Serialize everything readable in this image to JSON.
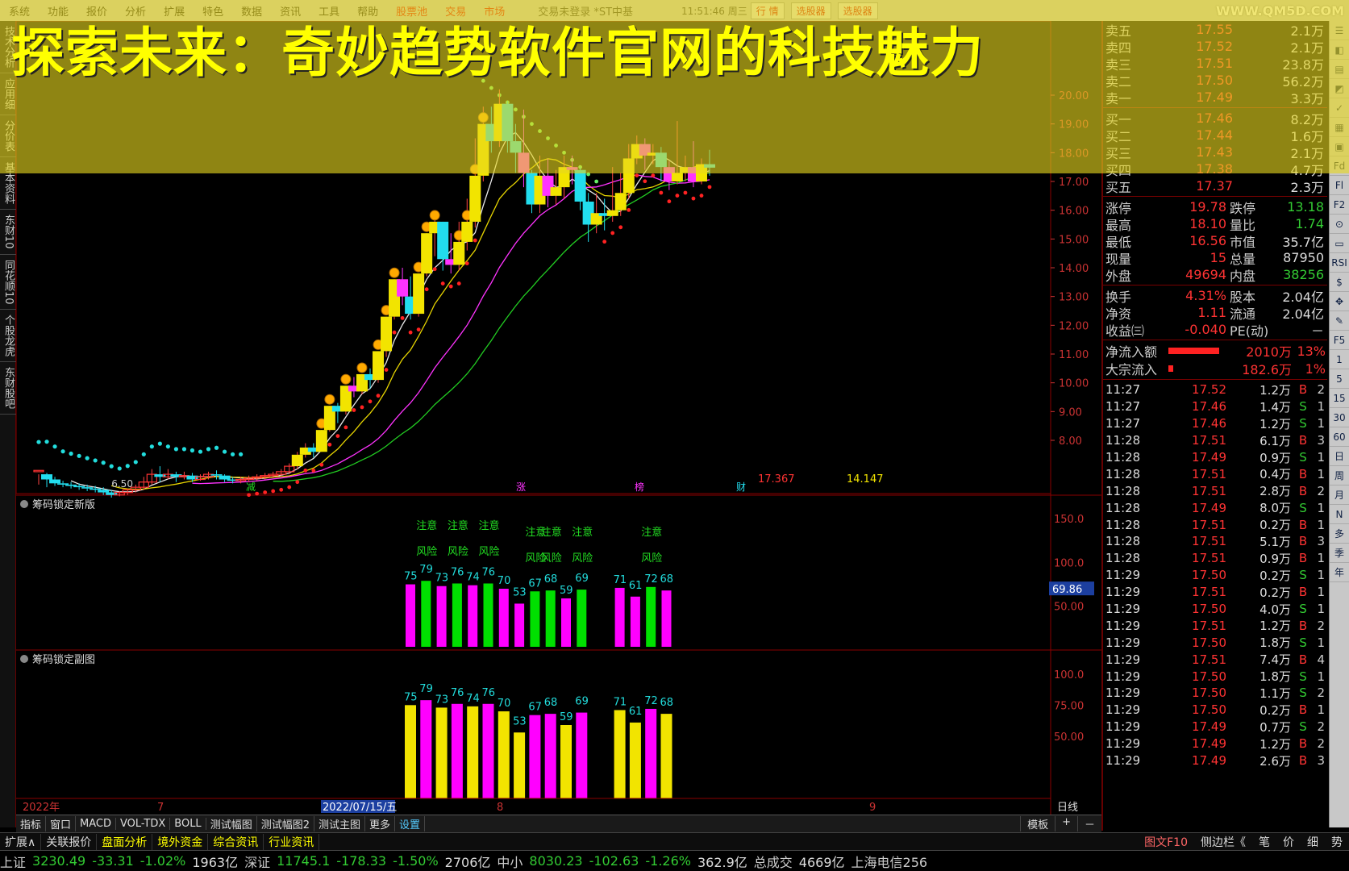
{
  "menubar": {
    "items": [
      "系统",
      "功能",
      "报价",
      "分析",
      "扩展",
      "特色",
      "数据",
      "资讯",
      "工具",
      "帮助"
    ],
    "red_items": [
      "股票池",
      "交易",
      "市场"
    ],
    "buttons": [
      "行 情",
      "选股器",
      "选股器"
    ],
    "window_title": "交易未登录 *ST中基",
    "clock": "11:51:46 周三",
    "site": "WWW.QM5D.COM"
  },
  "headline": "探索未来：奇妙趋势软件官网的科技魅力",
  "left_vertical_tabs": [
    "技术分析",
    "应用细",
    "分价表",
    "基本资料",
    "东财10",
    "同花顺10",
    "个股龙虎",
    "东财股吧"
  ],
  "right_toolbar": [
    "☰",
    "◧",
    "▤",
    "◩",
    "✓",
    "▦",
    "▣",
    "Fd",
    "Fl",
    "F2",
    "⊙",
    "▭",
    "RSI",
    "$",
    "✥",
    "✎",
    "F5",
    "1",
    "5",
    "15",
    "30",
    "60",
    "日",
    "周",
    "月",
    "N",
    "多",
    "季",
    "年"
  ],
  "quote": {
    "orderbook": [
      {
        "label": "卖五",
        "price": "17.55",
        "vol": "2.1万"
      },
      {
        "label": "卖四",
        "price": "17.52",
        "vol": "2.1万"
      },
      {
        "label": "卖三",
        "price": "17.51",
        "vol": "23.8万"
      },
      {
        "label": "卖二",
        "price": "17.50",
        "vol": "56.2万"
      },
      {
        "label": "卖一",
        "price": "17.49",
        "vol": "3.3万"
      },
      {
        "label": "买一",
        "price": "17.46",
        "vol": "8.2万"
      },
      {
        "label": "买二",
        "price": "17.44",
        "vol": "1.6万"
      },
      {
        "label": "买三",
        "price": "17.43",
        "vol": "2.1万"
      },
      {
        "label": "买四",
        "price": "17.38",
        "vol": "4.7万"
      },
      {
        "label": "买五",
        "price": "17.37",
        "vol": "2.3万"
      }
    ],
    "stats": [
      {
        "k1": "涨停",
        "v1": "19.78",
        "k2": "跌停",
        "v2": "13.18",
        "v2color": "g"
      },
      {
        "k1": "最高",
        "v1": "18.10",
        "k2": "量比",
        "v2": "1.74",
        "v2color": "g"
      },
      {
        "k1": "最低",
        "v1": "16.56",
        "k2": "市值",
        "v2": "35.7亿",
        "v2color": "w"
      },
      {
        "k1": "现量",
        "v1": "15",
        "k2": "总量",
        "v2": "87950",
        "v2color": "w"
      },
      {
        "k1": "外盘",
        "v1": "49694",
        "k2": "内盘",
        "v2": "38256",
        "v2color": "g"
      }
    ],
    "stats2": [
      {
        "k1": "换手",
        "v1": "4.31%",
        "k2": "股本",
        "v2": "2.04亿",
        "v2color": "w"
      },
      {
        "k1": "净资",
        "v1": "1.11",
        "k2": "流通",
        "v2": "2.04亿",
        "v2color": "w"
      },
      {
        "k1": "收益㈢",
        "v1": "-0.040",
        "k2": "PE(动)",
        "v2": "－",
        "v2color": "w"
      }
    ],
    "flows": [
      {
        "label": "净流入额",
        "value": "2010万",
        "pct": "13%",
        "bar": 0.9
      },
      {
        "label": "大宗流入",
        "value": "182.6万",
        "pct": "1%",
        "bar": 0.08
      }
    ],
    "ticks": [
      {
        "t": "11:27",
        "p": "17.52",
        "v": "1.2万",
        "bs": "B",
        "n": "2"
      },
      {
        "t": "11:27",
        "p": "17.46",
        "v": "1.4万",
        "bs": "S",
        "n": "1"
      },
      {
        "t": "11:27",
        "p": "17.46",
        "v": "1.2万",
        "bs": "S",
        "n": "1"
      },
      {
        "t": "11:28",
        "p": "17.51",
        "v": "6.1万",
        "bs": "B",
        "n": "3"
      },
      {
        "t": "11:28",
        "p": "17.49",
        "v": "0.9万",
        "bs": "S",
        "n": "1"
      },
      {
        "t": "11:28",
        "p": "17.51",
        "v": "0.4万",
        "bs": "B",
        "n": "1"
      },
      {
        "t": "11:28",
        "p": "17.51",
        "v": "2.8万",
        "bs": "B",
        "n": "2"
      },
      {
        "t": "11:28",
        "p": "17.49",
        "v": "8.0万",
        "bs": "S",
        "n": "1"
      },
      {
        "t": "11:28",
        "p": "17.51",
        "v": "0.2万",
        "bs": "B",
        "n": "1"
      },
      {
        "t": "11:28",
        "p": "17.51",
        "v": "5.1万",
        "bs": "B",
        "n": "3"
      },
      {
        "t": "11:28",
        "p": "17.51",
        "v": "0.9万",
        "bs": "B",
        "n": "1"
      },
      {
        "t": "11:29",
        "p": "17.50",
        "v": "0.2万",
        "bs": "S",
        "n": "1"
      },
      {
        "t": "11:29",
        "p": "17.51",
        "v": "0.2万",
        "bs": "B",
        "n": "1"
      },
      {
        "t": "11:29",
        "p": "17.50",
        "v": "4.0万",
        "bs": "S",
        "n": "1"
      },
      {
        "t": "11:29",
        "p": "17.51",
        "v": "1.2万",
        "bs": "B",
        "n": "2"
      },
      {
        "t": "11:29",
        "p": "17.50",
        "v": "1.8万",
        "bs": "S",
        "n": "1"
      },
      {
        "t": "11:29",
        "p": "17.51",
        "v": "7.4万",
        "bs": "B",
        "n": "4"
      },
      {
        "t": "11:29",
        "p": "17.50",
        "v": "1.8万",
        "bs": "S",
        "n": "1"
      },
      {
        "t": "11:29",
        "p": "17.50",
        "v": "1.1万",
        "bs": "S",
        "n": "2"
      },
      {
        "t": "11:29",
        "p": "17.50",
        "v": "0.2万",
        "bs": "B",
        "n": "1"
      },
      {
        "t": "11:29",
        "p": "17.49",
        "v": "0.7万",
        "bs": "S",
        "n": "2"
      },
      {
        "t": "11:29",
        "p": "17.49",
        "v": "1.2万",
        "bs": "B",
        "n": "2"
      },
      {
        "t": "11:29",
        "p": "17.49",
        "v": "2.6万",
        "bs": "B",
        "n": "3"
      }
    ]
  },
  "chart_data": {
    "type": "candlestick",
    "main_axis": {
      "labels": [
        "20.00",
        "19.00",
        "18.00",
        "17.00",
        "16.00",
        "15.00",
        "14.00",
        "13.00",
        "12.00",
        "11.00",
        "10.00",
        "9.00",
        "8.00"
      ],
      "range": [
        7.0,
        20.0
      ]
    },
    "low_label": "6.50",
    "high_label": "17.367",
    "mid_label": "14.147",
    "event_markers": [
      "减",
      "涨",
      "榜",
      "财"
    ],
    "candles": [
      [
        6.9,
        6.95,
        6.4,
        6.8
      ],
      [
        6.8,
        6.6,
        6.3,
        6.85
      ],
      [
        6.6,
        6.45,
        6.35,
        6.7
      ],
      [
        6.45,
        6.4,
        6.3,
        6.55
      ],
      [
        6.4,
        6.35,
        6.25,
        6.5
      ],
      [
        6.35,
        6.3,
        6.2,
        6.45
      ],
      [
        6.3,
        6.25,
        6.15,
        6.4
      ],
      [
        6.25,
        6.2,
        6.1,
        6.35
      ],
      [
        6.2,
        6.1,
        6.0,
        6.3
      ],
      [
        6.1,
        6.0,
        5.9,
        6.2
      ],
      [
        6.0,
        6.1,
        5.95,
        6.15
      ],
      [
        6.1,
        6.2,
        6.0,
        6.25
      ],
      [
        6.2,
        6.3,
        6.1,
        6.4
      ],
      [
        6.3,
        6.5,
        6.2,
        6.7
      ],
      [
        6.5,
        6.8,
        6.4,
        7.0
      ],
      [
        6.8,
        6.7,
        6.5,
        7.1
      ],
      [
        6.7,
        6.8,
        6.6,
        7.0
      ],
      [
        6.8,
        6.7,
        6.5,
        6.9
      ],
      [
        6.7,
        6.75,
        6.6,
        6.9
      ],
      [
        6.75,
        6.6,
        6.5,
        6.85
      ],
      [
        6.6,
        6.7,
        6.55,
        6.8
      ],
      [
        6.7,
        6.8,
        6.6,
        6.9
      ],
      [
        6.8,
        6.75,
        6.6,
        6.95
      ],
      [
        6.75,
        6.6,
        6.5,
        6.8
      ],
      [
        6.6,
        6.55,
        6.45,
        6.7
      ],
      [
        6.55,
        6.6,
        6.45,
        6.7
      ],
      [
        6.6,
        6.65,
        6.5,
        6.75
      ],
      [
        6.65,
        6.7,
        6.55,
        6.8
      ],
      [
        6.7,
        6.75,
        6.6,
        6.85
      ],
      [
        6.75,
        6.8,
        6.65,
        6.9
      ],
      [
        6.8,
        6.9,
        6.7,
        7.0
      ],
      [
        6.9,
        7.1,
        6.8,
        7.2
      ],
      [
        7.1,
        7.5,
        7.0,
        7.6
      ],
      [
        7.5,
        7.75,
        7.4,
        7.9
      ],
      [
        7.75,
        7.6,
        7.4,
        7.9
      ],
      [
        7.6,
        8.36,
        7.6,
        8.36
      ],
      [
        8.36,
        9.2,
        8.3,
        9.2
      ],
      [
        9.2,
        9.0,
        8.6,
        9.3
      ],
      [
        9.0,
        9.9,
        8.9,
        9.9
      ],
      [
        9.9,
        9.7,
        9.5,
        10.2
      ],
      [
        9.7,
        10.3,
        9.6,
        10.3
      ],
      [
        10.3,
        10.1,
        9.8,
        10.5
      ],
      [
        10.1,
        11.1,
        10.0,
        11.1
      ],
      [
        11.1,
        12.3,
        10.9,
        12.3
      ],
      [
        12.3,
        13.6,
        12.2,
        13.6
      ],
      [
        13.6,
        13.0,
        12.7,
        14.0
      ],
      [
        13.0,
        12.4,
        12.2,
        13.7
      ],
      [
        12.4,
        13.8,
        12.3,
        13.8
      ],
      [
        13.8,
        15.2,
        13.7,
        15.2
      ],
      [
        15.2,
        15.6,
        14.4,
        15.9
      ],
      [
        15.6,
        14.3,
        13.9,
        15.6
      ],
      [
        14.3,
        14.1,
        13.8,
        15.2
      ],
      [
        14.1,
        14.9,
        13.9,
        15.6
      ],
      [
        14.9,
        15.6,
        14.6,
        16.4
      ],
      [
        15.6,
        17.2,
        15.4,
        18.5
      ],
      [
        17.2,
        19.0,
        17.0,
        19.6
      ],
      [
        19.0,
        18.4,
        18.0,
        19.6
      ],
      [
        18.4,
        19.7,
        18.2,
        20.2
      ],
      [
        19.7,
        18.4,
        18.0,
        19.8
      ],
      [
        18.4,
        18.0,
        17.3,
        19.0
      ],
      [
        18.0,
        17.3,
        16.8,
        19.5
      ],
      [
        17.3,
        16.2,
        15.9,
        17.4
      ],
      [
        16.2,
        17.2,
        15.9,
        17.9
      ],
      [
        17.2,
        16.5,
        16.1,
        17.8
      ],
      [
        16.5,
        16.8,
        16.2,
        17.4
      ],
      [
        16.8,
        17.5,
        16.4,
        17.9
      ],
      [
        17.5,
        17.4,
        16.9,
        17.9
      ],
      [
        17.4,
        16.3,
        16.0,
        17.5
      ],
      [
        16.3,
        15.5,
        14.9,
        16.6
      ],
      [
        15.5,
        15.9,
        15.2,
        16.6
      ],
      [
        15.9,
        15.8,
        15.3,
        16.4
      ],
      [
        15.8,
        16.0,
        15.6,
        17.5
      ],
      [
        16.0,
        16.6,
        15.8,
        17.3
      ],
      [
        16.6,
        17.8,
        16.4,
        18.3
      ],
      [
        17.8,
        18.3,
        17.6,
        18.6
      ],
      [
        18.3,
        17.9,
        17.4,
        18.5
      ],
      [
        17.9,
        18.0,
        17.6,
        18.3
      ],
      [
        18.0,
        17.5,
        17.0,
        18.2
      ],
      [
        17.5,
        17.0,
        16.7,
        17.7
      ],
      [
        17.0,
        17.3,
        16.9,
        19.1
      ],
      [
        17.3,
        17.5,
        17.0,
        17.9
      ],
      [
        17.5,
        17.0,
        16.8,
        18.4
      ],
      [
        17.0,
        17.6,
        16.9,
        17.8
      ],
      [
        17.6,
        17.48,
        17.2,
        18.1
      ]
    ],
    "sub1": {
      "title": "筹码锁定新版",
      "axis": [
        "150.0",
        "100.0",
        "50.00"
      ],
      "range": [
        0,
        175
      ],
      "current": "69.86",
      "values": [
        75,
        79,
        73,
        76,
        74,
        76,
        70,
        53,
        67,
        68,
        59,
        69,
        71,
        61,
        72,
        68
      ],
      "colors": [
        "m",
        "g",
        "m",
        "g",
        "m",
        "g",
        "m",
        "m",
        "g",
        "g",
        "m",
        "g",
        "m",
        "m",
        "g",
        "m"
      ],
      "groups": [
        0,
        0,
        0,
        0,
        0,
        0,
        0,
        0,
        0,
        0,
        0,
        0,
        1,
        1,
        1,
        1
      ],
      "notes": [
        {
          "text": "注意",
          "bar": 1
        },
        {
          "text": "注意",
          "bar": 3
        },
        {
          "text": "注意",
          "bar": 5
        },
        {
          "text": "注意",
          "bar": 8
        },
        {
          "text": "注意",
          "bar": 9
        },
        {
          "text": "注意",
          "bar": 11
        },
        {
          "text": "注意",
          "bar": 14
        }
      ],
      "risks": [
        {
          "text": "风险",
          "bar": 1
        },
        {
          "text": "风险",
          "bar": 3
        },
        {
          "text": "风险",
          "bar": 5
        },
        {
          "text": "风险",
          "bar": 8
        },
        {
          "text": "风险",
          "bar": 9
        },
        {
          "text": "风险",
          "bar": 11
        },
        {
          "text": "风险",
          "bar": 14
        }
      ]
    },
    "sub2": {
      "title": "筹码锁定副图",
      "axis": [
        "100.0",
        "75.00",
        "50.00"
      ],
      "range": [
        0,
        118
      ],
      "values": [
        75,
        79,
        73,
        76,
        74,
        76,
        70,
        53,
        67,
        68,
        59,
        69,
        71,
        61,
        72,
        68
      ],
      "colors": [
        "y",
        "m",
        "y",
        "m",
        "y",
        "m",
        "y",
        "y",
        "m",
        "m",
        "y",
        "m",
        "y",
        "y",
        "m",
        "y"
      ]
    },
    "time_axis": {
      "labels": [
        "2022年",
        "7",
        "2022/07/15/五",
        "8",
        "9"
      ],
      "right": "日线"
    }
  },
  "tabs1": {
    "items": [
      "指标",
      "窗口",
      "MACD",
      "VOL-TDX",
      "BOLL",
      "测试幅图",
      "测试幅图2",
      "测试主图",
      "更多",
      "设置"
    ],
    "current": "设置",
    "right": [
      "模板",
      "+",
      "－"
    ]
  },
  "tabs2": {
    "items": [
      "扩展∧",
      "关联报价",
      "盘面分析",
      "境外资金",
      "综合资讯",
      "行业资讯"
    ],
    "right": [
      "图文F10",
      "侧边栏《",
      "笔",
      "价",
      "细",
      "势"
    ]
  },
  "status": [
    {
      "name": "上证",
      "val": "3230.49",
      "chg": "-33.31",
      "pct": "-1.02%",
      "amt": "1963亿"
    },
    {
      "name": "深证",
      "val": "11745.1",
      "chg": "-178.33",
      "pct": "-1.50%",
      "amt": "2706亿"
    },
    {
      "name": "中小",
      "val": "8030.23",
      "chg": "-102.63",
      "pct": "-1.26%",
      "amt": "362.9亿"
    }
  ],
  "status_total": {
    "label": "总成交",
    "amt": "4669亿",
    "ext": "上海电信256"
  },
  "colors": {
    "up": "#ff3333",
    "down": "#22ccdd",
    "yellow": "#f5e800",
    "magenta": "#ff00ff",
    "green": "#00e000"
  }
}
